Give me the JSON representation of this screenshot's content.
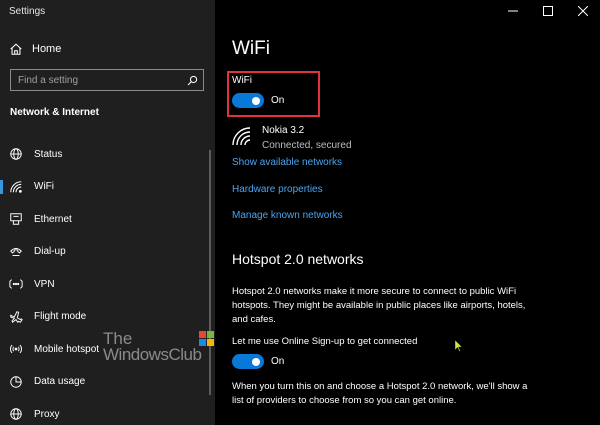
{
  "app": {
    "title": "Settings"
  },
  "sidebar": {
    "home_label": "Home",
    "search_placeholder": "Find a setting",
    "section_title": "Network & Internet",
    "items": [
      {
        "label": "Status",
        "icon": "globe-icon"
      },
      {
        "label": "WiFi",
        "icon": "wifi-icon",
        "active": true
      },
      {
        "label": "Ethernet",
        "icon": "ethernet-icon"
      },
      {
        "label": "Dial-up",
        "icon": "dial-up-icon"
      },
      {
        "label": "VPN",
        "icon": "vpn-icon"
      },
      {
        "label": "Flight mode",
        "icon": "airplane-icon"
      },
      {
        "label": "Mobile hotspot",
        "icon": "hotspot-icon"
      },
      {
        "label": "Data usage",
        "icon": "data-usage-icon"
      },
      {
        "label": "Proxy",
        "icon": "globe-icon"
      }
    ]
  },
  "watermark": {
    "line1": "The",
    "line2": "WindowsClub"
  },
  "main": {
    "title": "WiFi",
    "wifi_toggle": {
      "label": "WiFi",
      "state": "On"
    },
    "network": {
      "name": "Nokia 3.2",
      "status": "Connected, secured"
    },
    "links": {
      "show_networks": "Show available networks",
      "hardware_properties": "Hardware properties",
      "manage_known": "Manage known networks"
    },
    "hotspot": {
      "heading": "Hotspot 2.0 networks",
      "description": "Hotspot 2.0 networks make it more secure to connect to public WiFi hotspots. They might be available in public places like airports, hotels, and cafes.",
      "signup_label": "Let me use Online Sign-up to get connected",
      "signup_state": "On",
      "signup_note": "When you turn this on and choose a Hotspot 2.0 network, we'll show a list of providers to choose from so you can get online."
    }
  },
  "colors": {
    "accent": "#0a78d7",
    "link": "#4aa3f0",
    "highlight": "#e0343d",
    "sidebar_bg": "#1f1f1f"
  }
}
